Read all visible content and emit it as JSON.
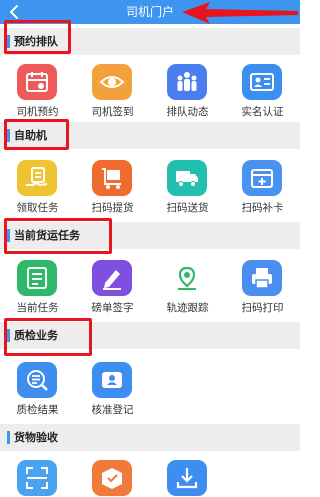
{
  "header": {
    "title": "司机门户",
    "back_icon": "chevron-left-icon"
  },
  "sections": [
    {
      "title": "预约排队",
      "items": [
        {
          "label": "司机预约",
          "icon": "calendar-icon",
          "color": "#ee5a5a"
        },
        {
          "label": "司机签到",
          "icon": "eye-icon",
          "color": "#f2a13c"
        },
        {
          "label": "排队动态",
          "icon": "people-icon",
          "color": "#4b7ff0"
        },
        {
          "label": "实名认证",
          "icon": "id-card-icon",
          "color": "#3a8ff0"
        }
      ]
    },
    {
      "title": "自助机",
      "items": [
        {
          "label": "领取任务",
          "icon": "task-hand-icon",
          "color": "#f0c431"
        },
        {
          "label": "扫码提货",
          "icon": "cart-icon",
          "color": "#ef6b2e"
        },
        {
          "label": "扫码送货",
          "icon": "truck-icon",
          "color": "#22bfae"
        },
        {
          "label": "扫码补卡",
          "icon": "calendar-plus-icon",
          "color": "#4a92f0"
        }
      ]
    },
    {
      "title": "当前货运任务",
      "items": [
        {
          "label": "当前任务",
          "icon": "form-icon",
          "color": "#2fb86a"
        },
        {
          "label": "磅单签字",
          "icon": "pen-icon",
          "color": "#7e4fe0"
        },
        {
          "label": "轨迹跟踪",
          "icon": "location-icon",
          "color": "#2fb86a"
        },
        {
          "label": "扫码打印",
          "icon": "printer-icon",
          "color": "#4a8ff0"
        }
      ]
    },
    {
      "title": "质检业务",
      "items": [
        {
          "label": "质检结果",
          "icon": "search-list-icon",
          "color": "#3d8ef0"
        },
        {
          "label": "核准登记",
          "icon": "person-card-icon",
          "color": "#3d8ef0"
        }
      ]
    },
    {
      "title": "货物验收",
      "items": [
        {
          "label": "",
          "icon": "scan-icon",
          "color": "#4aa3f0"
        },
        {
          "label": "",
          "icon": "box-check-icon",
          "color": "#ef7a3c"
        },
        {
          "label": "",
          "icon": "download-icon",
          "color": "#3d8ef0"
        }
      ]
    }
  ],
  "annotations": {
    "highlight_color": "#e8141e"
  }
}
